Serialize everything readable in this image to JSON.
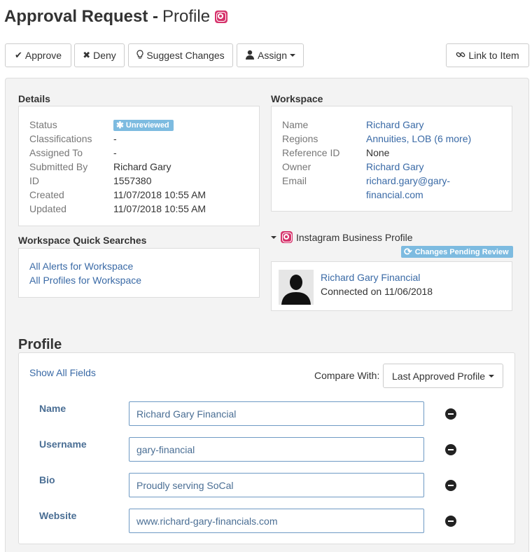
{
  "header": {
    "title_bold": "Approval Request -",
    "title_rest": "Profile",
    "platform_icon": "instagram-icon"
  },
  "toolbar": {
    "approve": "Approve",
    "deny": "Deny",
    "suggest": "Suggest Changes",
    "assign": "Assign",
    "link": "Link to Item"
  },
  "details": {
    "heading": "Details",
    "rows": [
      {
        "key": "Status",
        "value": "Unreviewed"
      },
      {
        "key": "Classifications",
        "value": "-"
      },
      {
        "key": "Assigned To",
        "value": "-"
      },
      {
        "key": "Submitted By",
        "value": "Richard Gary"
      },
      {
        "key": "ID",
        "value": "1557380"
      },
      {
        "key": "Created",
        "value": "11/07/2018 10:55 AM"
      },
      {
        "key": "Updated",
        "value": "11/07/2018 10:55 AM"
      }
    ]
  },
  "workspace": {
    "heading": "Workspace",
    "rows": [
      {
        "key": "Name",
        "value": "Richard Gary"
      },
      {
        "key": "Regions",
        "value": "Annuities, LOB (6 more)"
      },
      {
        "key": "Reference ID",
        "value": "None"
      },
      {
        "key": "Owner",
        "value": "Richard Gary"
      },
      {
        "key": "Email",
        "value_line1": "richard.gary@gary-",
        "value_line2": "financial.com"
      }
    ]
  },
  "quick_searches": {
    "heading": "Workspace Quick Searches",
    "links": [
      "All Alerts for Workspace",
      "All Profiles for Workspace"
    ]
  },
  "business_profile": {
    "heading": "Instagram Business Profile",
    "badge": "Changes Pending Review",
    "name": "Richard Gary Financial",
    "connected": "Connected on 11/06/2018"
  },
  "profile": {
    "heading": "Profile",
    "show_all": "Show All Fields",
    "compare_label": "Compare With:",
    "compare_value": "Last Approved Profile",
    "fields": [
      {
        "label": "Name",
        "value": "Richard Gary Financial"
      },
      {
        "label": "Username",
        "value": "gary-financial"
      },
      {
        "label": "Bio",
        "value": "Proudly serving SoCal"
      },
      {
        "label": "Website",
        "value": "www.richard-gary-financials.com"
      }
    ]
  },
  "colors": {
    "link": "#3a6aa6",
    "badge": "#7dbbe0",
    "instagram": "#d6336c"
  }
}
